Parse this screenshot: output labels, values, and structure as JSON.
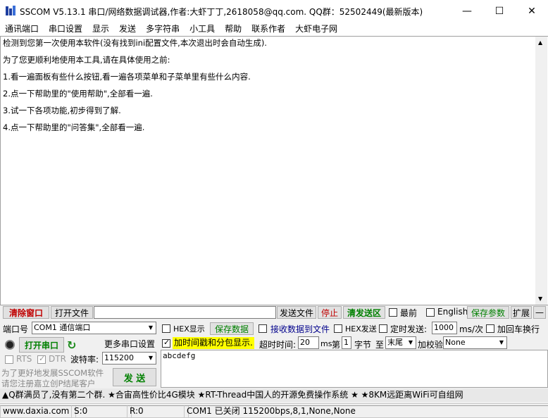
{
  "window": {
    "title": "SSCOM V5.13.1 串口/网络数据调试器,作者:大虾丁丁,2618058@qq.com. QQ群：52502449(最新版本)",
    "minimize": "—",
    "maximize": "☐",
    "close": "✕"
  },
  "menu": [
    "通讯端口",
    "串口设置",
    "显示",
    "发送",
    "多字符串",
    "小工具",
    "帮助",
    "联系作者",
    "大虾电子网"
  ],
  "receive": {
    "lines": [
      "检测到您第一次使用本软件(没有找到ini配置文件,本次退出时会自动生成).",
      "为了您更顺利地使用本工具,请在具体使用之前:",
      "1.看一遍面板有些什么按钮,看一遍各项菜单和子菜单里有些什么内容.",
      "2.点一下帮助里的\"使用帮助\",全部看一遍.",
      "3.试一下各项功能,初步得到了解.",
      "4.点一下帮助里的\"问答集\",全部看一遍."
    ]
  },
  "toolbar": {
    "clear_window": "清除窗口",
    "open_file": "打开文件",
    "file_path": "",
    "send_file": "发送文件",
    "stop": "停止",
    "clear_send": "清发送区",
    "topmost": "最前",
    "english": "English",
    "save_params": "保存参数",
    "expand": "扩展",
    "collapse": "—"
  },
  "port": {
    "label": "端口号",
    "value": "COM1 通信端口",
    "open_port": "打开串口",
    "more_settings": "更多串口设置",
    "rts": "RTS",
    "dtr": "DTR",
    "baud_label": "波特率:",
    "baud_value": "115200"
  },
  "options": {
    "hex_display": "HEX显示",
    "save_data": "保存数据",
    "recv_to_file": "接收数据到文件",
    "hex_send": "HEX发送",
    "timed_send": "定时发送:",
    "interval_value": "1000",
    "interval_unit": "ms/次",
    "add_newline": "加回车换行",
    "timestamp": "加时间戳和分包显示.",
    "timeout_label": "超时时间:",
    "timeout_value": "20",
    "timeout_unit": "ms",
    "nth_label": "第",
    "nth_value": "1",
    "byte_label": "字节",
    "to_label": "至",
    "to_value": "末尾",
    "checksum_label": "加校验",
    "checksum_value": "None"
  },
  "send": {
    "text": "abcdefg",
    "send_button": "发 送",
    "promo_line1": "为了更好地发展SSCOM软件",
    "promo_line2": "请您注册嘉立创P结尾客户"
  },
  "marquee": "▲Q群满员了,没有第二个群. ★合宙高性价比4G模块 ★RT-Thread中国人的开源免费操作系统 ★ ★8KM远距离WiFi可自组网",
  "status": {
    "website": "www.daxia.com",
    "sent": "S:0",
    "received": "R:0",
    "port_info": "COM1 已关闭  115200bps,8,1,None,None"
  },
  "colors": {
    "accent_green": "#008000",
    "accent_red": "#c00000",
    "highlight_yellow": "#ffff00"
  }
}
